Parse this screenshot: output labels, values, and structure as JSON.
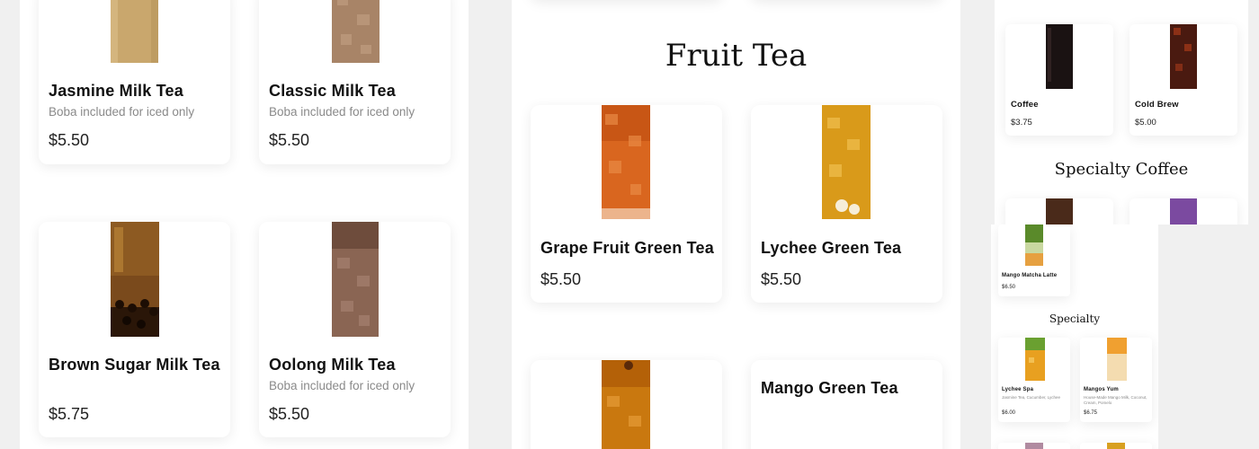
{
  "colors": {
    "page_bg": "#f0f0f0",
    "card_bg": "#ffffff",
    "muted_text": "#8a8a8a",
    "jasmine_milk_tea": "#c9a76d",
    "classic_milk_tea": "#a88467",
    "brown_sugar": "#5a3510",
    "oolong_milk_tea": "#8a6553",
    "grape_fruit_tea": "#d9661f",
    "lychee_tea": "#d99a1a",
    "mango_tea": "#c9780f",
    "coffee": "#1a1212",
    "cold_brew": "#4a1a10",
    "matcha": "#5a8a2a",
    "mango": "#e6a040",
    "purple": "#7b4aa0"
  },
  "left_panel": {
    "items": [
      {
        "name": "Jasmine Milk Tea",
        "desc": "Boba included for iced only",
        "price": "$5.50",
        "icon": "jasmine-milk-tea-cup"
      },
      {
        "name": "Classic Milk Tea",
        "desc": "Boba included for iced only",
        "price": "$5.50",
        "icon": "classic-milk-tea-cup"
      },
      {
        "name": "Brown Sugar Milk Tea",
        "desc": "",
        "price": "$5.75",
        "icon": "brown-sugar-milk-tea-cup"
      },
      {
        "name": "Oolong Milk Tea",
        "desc": "Boba included for iced only",
        "price": "$5.50",
        "icon": "oolong-milk-tea-cup"
      }
    ]
  },
  "middle_panel": {
    "section_title": "Fruit Tea",
    "items": [
      {
        "name": "Grape Fruit Green Tea",
        "price": "$5.50",
        "icon": "grape-fruit-green-tea-cup"
      },
      {
        "name": "Lychee Green Tea",
        "price": "$5.50",
        "icon": "lychee-green-tea-cup"
      },
      {
        "name": "",
        "price": "",
        "icon": "fruit-tea-cup"
      },
      {
        "name": "Mango Green Tea",
        "price": "",
        "icon": ""
      }
    ]
  },
  "right_panel": {
    "items": [
      {
        "name": "Coffee",
        "price": "$3.75",
        "icon": "coffee-cup"
      },
      {
        "name": "Cold Brew",
        "price": "$5.00",
        "icon": "cold-brew-cup"
      }
    ],
    "section_title": "Specialty Coffee"
  },
  "mini_panel": {
    "top_item": {
      "name": "Mango Matcha Latte",
      "price": "$6.50"
    },
    "section_title": "Specialty",
    "items": [
      {
        "name": "Lychee Spa",
        "desc": "Jasmine Tea, Cucumber, Lychee",
        "price": "$6.00"
      },
      {
        "name": "Mangos Yum",
        "desc": "House-Made Mango Milk, Coconut, Cream, Pomelo",
        "price": "$6.75"
      }
    ]
  }
}
